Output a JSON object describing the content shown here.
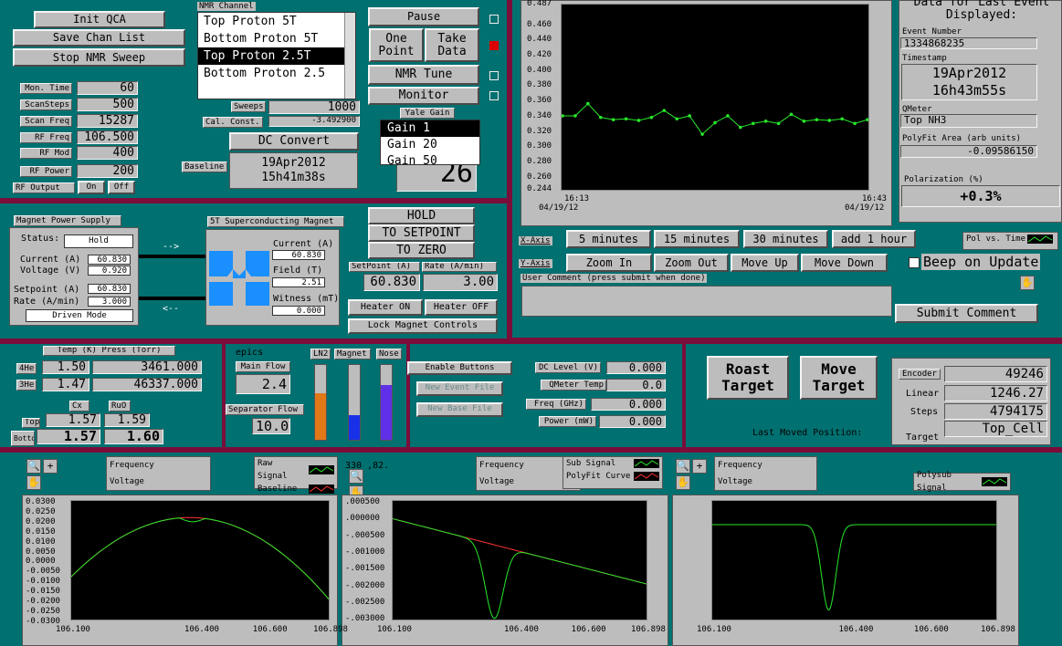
{
  "colors": {
    "bg": "#017070",
    "divider": "#7a0d3a",
    "plot_bg": "#000000",
    "trace_green": "#27e82a",
    "trace_red": "#ff3535"
  },
  "top_buttons": {
    "init": "Init QCA",
    "save": "Save Chan List",
    "stop": "Stop NMR Sweep"
  },
  "nmr_channel": {
    "title": "NMR Channel",
    "items": [
      "Top Proton 5T",
      "Bottom Proton 5T",
      "Top Proton 2.5T",
      "Bottom Proton 2.5"
    ],
    "selected_index": 2
  },
  "rf": {
    "rows": [
      {
        "label": "Mon. Time",
        "value": "60"
      },
      {
        "label": "ScanSteps",
        "value": "500"
      },
      {
        "label": "Scan Freq",
        "value": "15287"
      },
      {
        "label": "RF Freq",
        "value": "106.500"
      },
      {
        "label": "RF Mod",
        "value": "400"
      },
      {
        "label": "RF Power",
        "value": "200"
      }
    ],
    "output_label": "RF Output",
    "on": "On",
    "off": "Off"
  },
  "sweeps": {
    "label": "Sweeps",
    "value": "1000",
    "cal_label": "Cal. Const.",
    "cal_value": "-3.492900"
  },
  "dc_convert": "DC Convert",
  "baseline": {
    "label": "Baseline",
    "date": "19Apr2012",
    "time": "15h41m38s"
  },
  "controls": {
    "pause": "Pause",
    "one_point": "One Point",
    "take_data": "Take Data",
    "nmr_tune": "NMR Tune",
    "monitor": "Monitor"
  },
  "yale_gain": {
    "title": "Yale Gain",
    "items": [
      "Gain 1",
      "Gain 20",
      "Gain 50"
    ],
    "selected_index": 0,
    "readout": "26"
  },
  "strip_chart": {
    "y_ticks": [
      "0.487",
      "0.460",
      "0.440",
      "0.420",
      "0.400",
      "0.380",
      "0.360",
      "0.340",
      "0.320",
      "0.300",
      "0.280",
      "0.260",
      "0.244"
    ],
    "x_left": "16:13",
    "x_left_date": "04/19/12",
    "x_right": "16:43",
    "x_right_date": "04/19/12"
  },
  "chart_data": {
    "type": "line",
    "ylim": [
      0.244,
      0.487
    ],
    "x": [
      "16:13",
      "16:43"
    ],
    "series": [
      {
        "values": [
          0.341,
          0.341,
          0.357,
          0.339,
          0.336,
          0.337,
          0.335,
          0.339,
          0.348,
          0.337,
          0.341,
          0.317,
          0.332,
          0.341,
          0.326,
          0.331,
          0.334,
          0.331,
          0.343,
          0.334,
          0.336,
          0.335,
          0.337,
          0.331,
          0.336
        ]
      }
    ]
  },
  "last_event": {
    "title": "Data for Last Event Displayed:",
    "event_label": "Event Number",
    "event": "1334868235",
    "ts_label": "Timestamp",
    "date": "19Apr2012",
    "time": "16h43m55s",
    "qmeter_label": "QMeter",
    "qmeter": "Top NH3",
    "polyfit_label": "PolyFit Area (arb units)",
    "polyfit": "-0.09586150",
    "pol_label": "Polarization (%)",
    "pol": "+0.3%"
  },
  "xaxis": {
    "label": "X-Axis",
    "buttons": [
      "5 minutes",
      "15 minutes",
      "30 minutes",
      "add 1 hour"
    ]
  },
  "yaxis": {
    "label": "Y-Axis",
    "buttons": [
      "Zoom In",
      "Zoom Out",
      "Move Up",
      "Move Down"
    ]
  },
  "pol_vs_time": "Pol vs. Time",
  "beep": "Beep on Update",
  "comment": {
    "label": "User Comment (press submit when done)",
    "submit": "Submit Comment"
  },
  "magnet_ps": {
    "title": "Magnet Power Supply",
    "status_label": "Status:",
    "status": "Hold",
    "current_label": "Current (A)",
    "current": "60.830",
    "voltage_label": "Voltage (V)",
    "voltage": "0.920",
    "setpoint_label": "Setpoint (A)",
    "setpoint": "60.830",
    "rate_label": "Rate (A/min)",
    "rate": "3.000",
    "mode": "Driven Mode"
  },
  "sc_magnet": {
    "title": "5T Superconducting Magnet",
    "current_label": "Current (A)",
    "current": "60.830",
    "field_label": "Field (T)",
    "field": "2.51",
    "witness_label": "Witness (mT)",
    "witness": "0.000"
  },
  "hold_buttons": {
    "hold": "HOLD",
    "to_setpoint": "TO SETPOINT",
    "to_zero": "TO ZERO"
  },
  "setpoint_rate": {
    "sp_label": "SetPoint (A)",
    "sp": "60.830",
    "rate_label": "Rate (A/min)",
    "rate": "3.00"
  },
  "heater": {
    "on": "Heater ON",
    "off": "Heater OFF",
    "lock": "Lock Magnet Controls"
  },
  "temps": {
    "header": "Temp (K) Press (Torr)",
    "he4_label": "4He",
    "he4_temp": "1.50",
    "he4_press": "3461.000",
    "he3_label": "3He",
    "he3_temp": "1.47",
    "he3_press": "46337.000",
    "cx": "Cx",
    "ruo": "RuO",
    "top_label": "Top",
    "top_cx": "1.57",
    "top_ruo": "1.59",
    "bot_label": "Bottom",
    "bot_cx": "1.57",
    "bot_ruo": "1.60"
  },
  "flow": {
    "epics": "epics",
    "main_label": "Main Flow",
    "main": "2.4",
    "sep_label": "Separator Flow",
    "sep": "10.0",
    "ln2": "LN2",
    "magnet": "Magnet",
    "nose": "Nose",
    "levels": [
      0.62,
      0.33,
      0.73
    ]
  },
  "files": {
    "enable": "Enable Buttons",
    "new_event": "New Event File",
    "new_base": "New Base File"
  },
  "dc_level": {
    "rows": [
      {
        "label": "DC Level (V)",
        "value": "0.000"
      },
      {
        "label": "QMeter Temp",
        "value": "0.0"
      },
      {
        "label": "Freq (GHz)",
        "value": "0.000"
      },
      {
        "label": "Power (mW)",
        "value": "0.000"
      }
    ]
  },
  "target": {
    "roast": "Roast Target",
    "move": "Move Target",
    "last_moved": "Last Moved Position:",
    "encoder_label": "Encoder",
    "encoder": "49246",
    "linear_label": "Linear",
    "linear": "1246.27",
    "steps_label": "Steps",
    "steps": "4794175",
    "target_label": "Target",
    "target": "Top_Cell"
  },
  "signal_plots": {
    "x_ticks": [
      "106.100",
      "106.400",
      "106.600",
      "106.898"
    ],
    "p1_y": [
      "0.0300",
      "0.0250",
      "0.0200",
      "0.0150",
      "0.0100",
      "0.0050",
      "0.0000",
      "-0.0050",
      "-0.0100",
      "-0.0150",
      "-0.0200",
      "-0.0250",
      "-0.0300"
    ],
    "p2_y": [
      ".000500",
      ".000000",
      "-.000500",
      "-.001000",
      "-.001500",
      "-.002000",
      "-.002500",
      "-.003000"
    ],
    "raw": "Raw Signal",
    "baseline": "Baseline",
    "sub": "Sub Signal",
    "polyfit": "PolyFit Curve",
    "polysub": "Polysub Signal",
    "frequency": "Frequency",
    "voltage": "Voltage",
    "coords": "330 ,82."
  }
}
